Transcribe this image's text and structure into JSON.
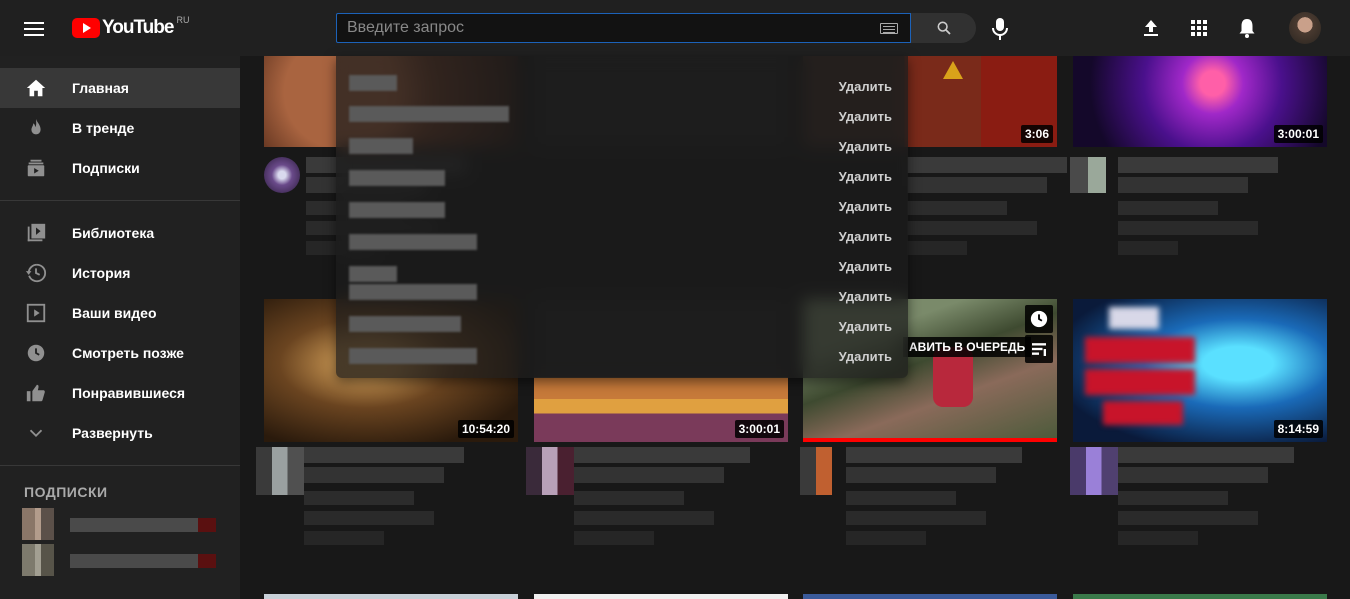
{
  "header": {
    "logo_text": "YouTube",
    "logo_region": "RU",
    "search_placeholder": "Введите запрос",
    "search_value": ""
  },
  "colors": {
    "brand_red": "#ff0000",
    "background": "#181818",
    "sidebar": "#212121",
    "topbar": "#202020",
    "focus_border": "#1c62b9"
  },
  "sidebar": {
    "items": [
      {
        "label": "Главная",
        "icon": "home-icon"
      },
      {
        "label": "В тренде",
        "icon": "flame-icon"
      },
      {
        "label": "Подписки",
        "icon": "subscriptions-icon"
      },
      {
        "label": "Библиотека",
        "icon": "library-icon"
      },
      {
        "label": "История",
        "icon": "history-icon"
      },
      {
        "label": "Ваши видео",
        "icon": "your-videos-icon"
      },
      {
        "label": "Смотреть позже",
        "icon": "watch-later-icon"
      },
      {
        "label": "Понравившиеся",
        "icon": "like-icon"
      },
      {
        "label": "Развернуть",
        "icon": "chevron-down-icon"
      }
    ],
    "subscriptions_title": "ПОДПИСКИ"
  },
  "search_suggestions": {
    "delete_label": "Удалить",
    "count": 10
  },
  "videos": {
    "row1": [
      {
        "duration": ""
      },
      {
        "duration": ""
      },
      {
        "duration": "3:06"
      },
      {
        "duration": "3:00:01"
      }
    ],
    "row2": [
      {
        "duration": "10:54:20"
      },
      {
        "duration": "3:00:01"
      },
      {
        "duration": "",
        "queue_label": "АВИТЬ В ОЧЕРЕДЬ",
        "watch_progress": 1.0
      },
      {
        "duration": "8:14:59"
      }
    ]
  }
}
